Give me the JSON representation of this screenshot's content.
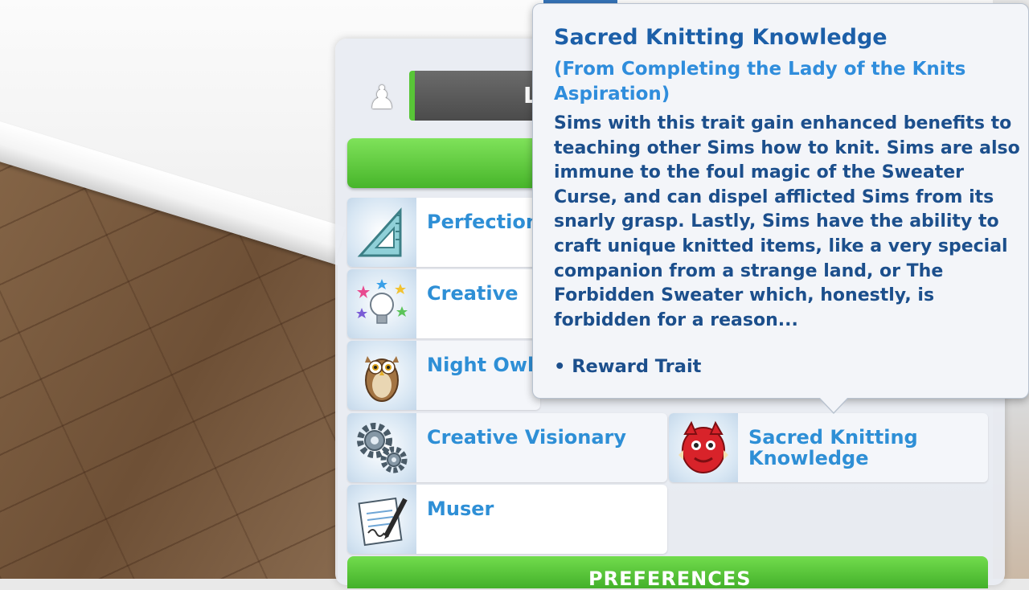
{
  "sim": {
    "name_initial": "L"
  },
  "traits": [
    {
      "label": "Perfectionist",
      "icon": "set-square-ruler-icon"
    },
    {
      "label": "Creative",
      "icon": "lightbulb-stars-icon"
    },
    {
      "label": "Night Owl",
      "icon": "owl-icon"
    },
    {
      "label": "Creative Visionary",
      "icon": "gears-icon"
    },
    {
      "label": "Muser",
      "icon": "notepad-pen-icon"
    },
    {
      "label": "Sacred Knitting Knowledge",
      "icon": "red-knit-creature-icon"
    }
  ],
  "tooltip": {
    "title": "Sacred Knitting Knowledge",
    "subtitle": "(From Completing the Lady of the Knits Aspiration)",
    "description": "Sims with this trait gain enhanced benefits to teaching other Sims how to knit. Sims are also immune to the foul magic of the Sweater Curse, and can dispel afflicted Sims from its snarly grasp. Lastly, Sims have the ability to craft unique knitted items, like a very special companion from a strange land, or The Forbidden Sweater which, honestly, is forbidden for a reason...",
    "bullet": "• Reward Trait"
  },
  "bottom_bar": {
    "label": "PREFERENCES"
  }
}
